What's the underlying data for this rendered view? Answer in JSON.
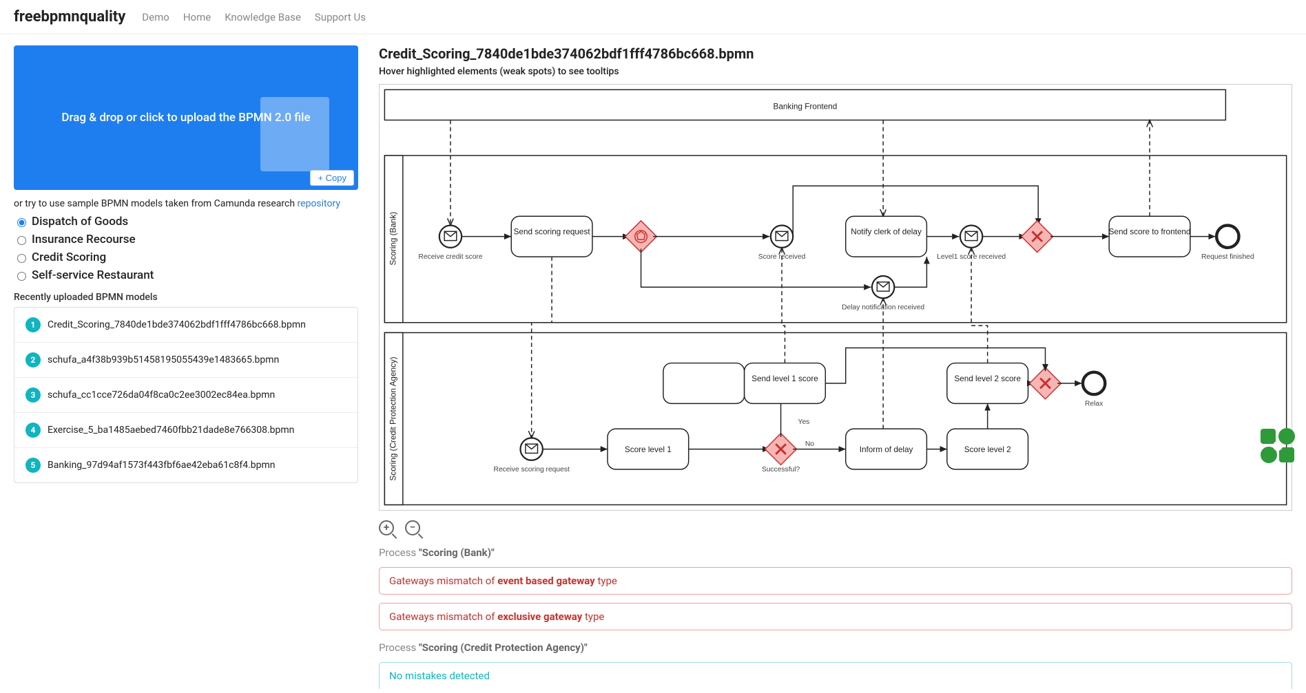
{
  "nav": {
    "brand": "freebpmnquality",
    "links": [
      "Demo",
      "Home",
      "Knowledge Base",
      "Support Us"
    ]
  },
  "dropzone": {
    "text": "Drag & drop or click to upload the BPMN 2.0 file",
    "copy_label": "+ Copy"
  },
  "sample": {
    "prefix": "or try to use sample BPMN models taken from Camunda research ",
    "link": "repository"
  },
  "samples": [
    {
      "label": "Dispatch of Goods",
      "checked": true
    },
    {
      "label": "Insurance Recourse",
      "checked": false
    },
    {
      "label": "Credit Scoring",
      "checked": false
    },
    {
      "label": "Self-service Restaurant",
      "checked": false
    }
  ],
  "recent_title": "Recently uploaded BPMN models",
  "recent": [
    "Credit_Scoring_7840de1bde374062bdf1fff4786bc668.bpmn",
    "schufa_a4f38b939b51458195055439e1483665.bpmn",
    "schufa_cc1cce726da04f8ca0c2ee3002ec84ea.bpmn",
    "Exercise_5_ba1485aebed7460fbb21dade8e766308.bpmn",
    "Banking_97d94af1573f443fbf6ae42eba61c8f4.bpmn"
  ],
  "file": {
    "title": "Credit_Scoring_7840de1bde374062bdf1fff4786bc668.bpmn",
    "subtitle": "Hover highlighted elements (weak spots) to see tooltips"
  },
  "diagram": {
    "pool_top": "Banking Frontend",
    "lane1": "Scoring (Bank)",
    "lane2": "Scoring (Credit Protection Agency)",
    "bank": {
      "start": "Receive credit score",
      "task_send": "Send scoring request",
      "evt_score": "Score received",
      "task_notify": "Notify clerk of delay",
      "evt_level1": "Level1 score received",
      "task_send_front": "Send score to frontend",
      "end": "Request finished",
      "evt_delay": "Delay notification received"
    },
    "agency": {
      "start": "Receive scoring request",
      "task_score1": "Score level 1",
      "gate_label_yes": "Yes",
      "gate_label_no": "No",
      "gate_q": "Successful?",
      "task_send1": "Send level 1 score",
      "task_inform": "Inform of delay",
      "task_score2": "Score level 2",
      "task_send2": "Send level 2 score",
      "end": "Relax"
    }
  },
  "results": {
    "proc1_label_prefix": "Process ",
    "proc1_name": "\"Scoring (Bank)\"",
    "err1_prefix": "Gateways mismatch of ",
    "err1_bold": "event based gateway",
    "err1_suffix": " type",
    "err2_prefix": "Gateways mismatch of ",
    "err2_bold": "exclusive gateway",
    "err2_suffix": " type",
    "proc2_label_prefix": "Process ",
    "proc2_name": "\"Scoring (Credit Protection Agency)\"",
    "ok_msg": "No mistakes detected"
  }
}
